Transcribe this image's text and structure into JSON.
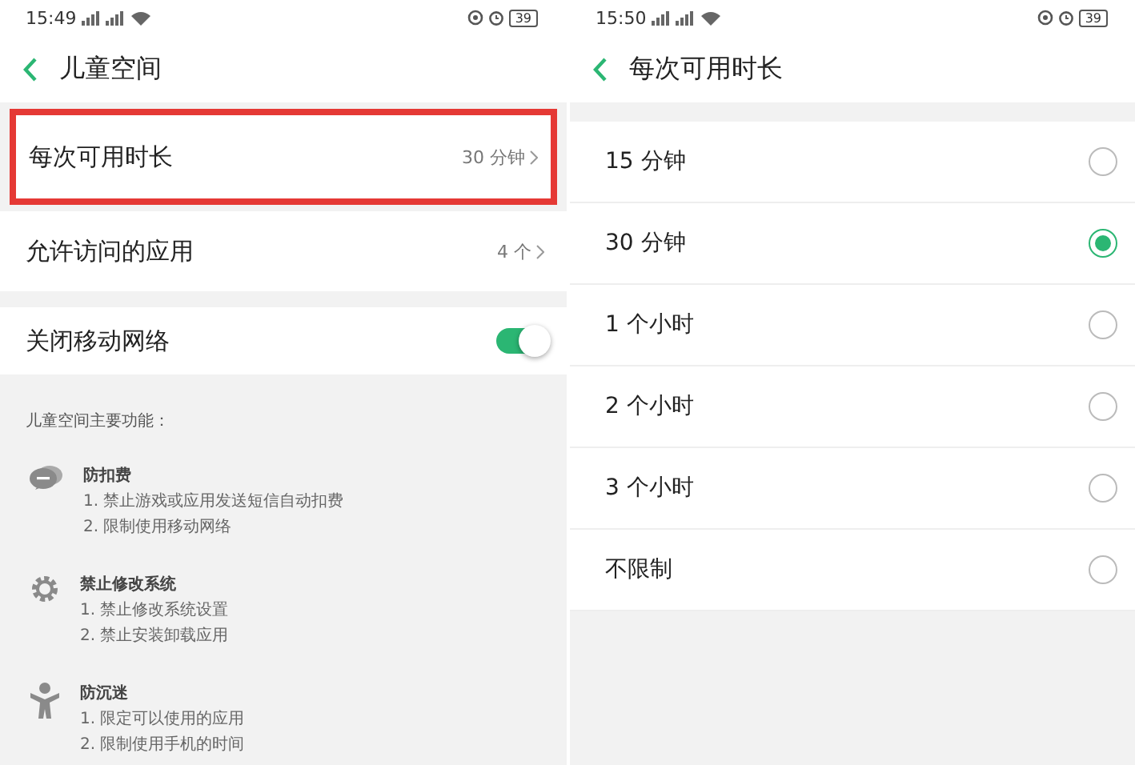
{
  "left": {
    "status": {
      "time": "15:49",
      "battery": "39"
    },
    "title": "儿童空间",
    "settings": [
      {
        "kind": "link",
        "label": "每次可用时长",
        "value": "30 分钟",
        "highlighted": true
      },
      {
        "kind": "link",
        "label": "允许访问的应用",
        "value": "4 个",
        "highlighted": false
      },
      {
        "kind": "toggle",
        "label": "关闭移动网络",
        "on": true,
        "highlighted": false
      }
    ],
    "features_heading": "儿童空间主要功能：",
    "features": [
      {
        "title": "防扣费",
        "lines": [
          "1. 禁止游戏或应用发送短信自动扣费",
          "2. 限制使用移动网络"
        ]
      },
      {
        "title": "禁止修改系统",
        "lines": [
          "1. 禁止修改系统设置",
          "2. 禁止安装卸载应用"
        ]
      },
      {
        "title": "防沉迷",
        "lines": [
          "1. 限定可以使用的应用",
          "2. 限制使用手机的时间"
        ]
      }
    ]
  },
  "right": {
    "status": {
      "time": "15:50",
      "battery": "39"
    },
    "title": "每次可用时长",
    "options": [
      {
        "label": "15 分钟",
        "selected": false
      },
      {
        "label": "30 分钟",
        "selected": true
      },
      {
        "label": "1 个小时",
        "selected": false
      },
      {
        "label": "2 个小时",
        "selected": false
      },
      {
        "label": "3 个小时",
        "selected": false
      },
      {
        "label": "不限制",
        "selected": false
      }
    ]
  }
}
